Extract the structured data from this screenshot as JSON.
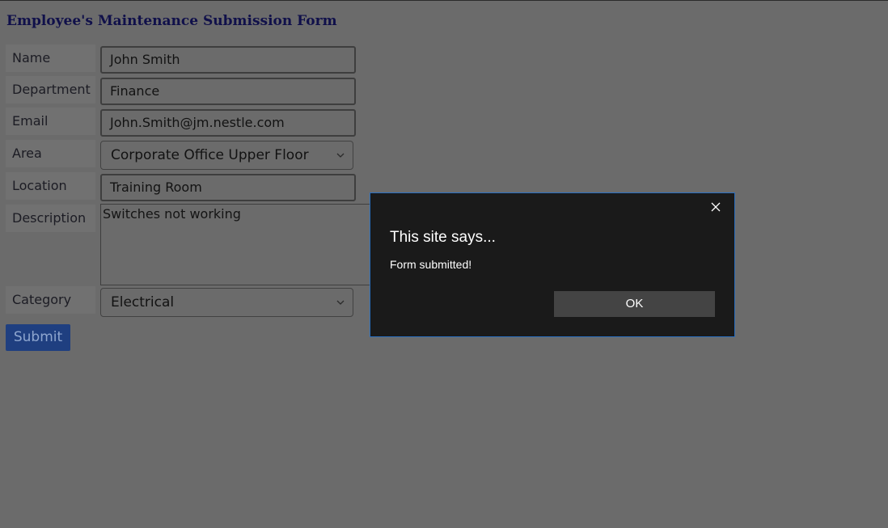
{
  "form": {
    "title": "Employee's Maintenance Submission Form",
    "fields": {
      "name": {
        "label": "Name",
        "value": "John Smith"
      },
      "department": {
        "label": "Department",
        "value": "Finance"
      },
      "email": {
        "label": "Email",
        "value": "John.Smith@jm.nestle.com"
      },
      "area": {
        "label": "Area",
        "value": "Corporate Office Upper Floor"
      },
      "location": {
        "label": "Location",
        "value": "Training Room"
      },
      "description": {
        "label": "Description",
        "value": "Switches not working"
      },
      "category": {
        "label": "Category",
        "value": "Electrical"
      }
    },
    "submit_label": "Submit"
  },
  "dialog": {
    "heading": "This site says...",
    "message": "Form submitted!",
    "ok_label": "OK",
    "close_icon": "close-icon"
  },
  "colors": {
    "overlay_background": "#6b6b6b",
    "title": "#10104a",
    "submit_button": "#1f3f80",
    "dialog_background": "#1a1a1a",
    "dialog_border": "#2a6fc0",
    "ok_button": "#444444"
  }
}
